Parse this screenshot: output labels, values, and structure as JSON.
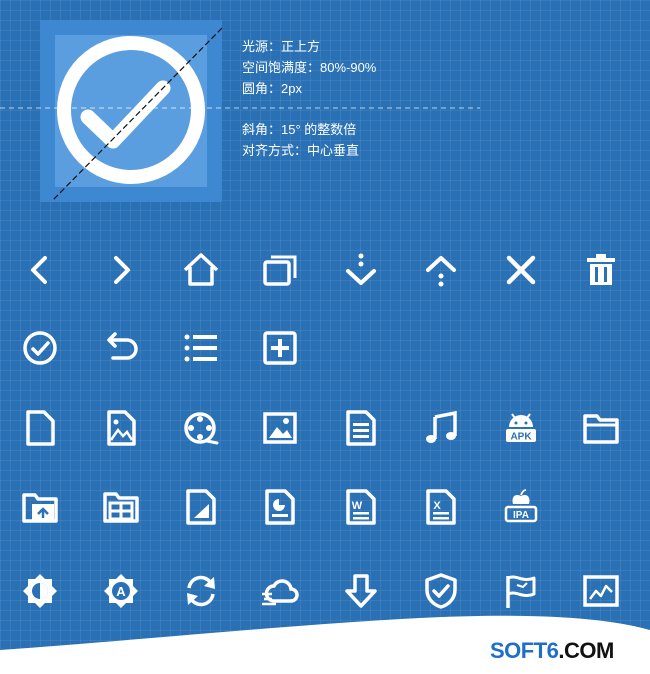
{
  "spec": {
    "lines_top": [
      "光源：正上方",
      "空间饱满度：80%-90%",
      "圆角：2px"
    ],
    "lines_bottom": [
      "斜角：15° 的整数倍",
      "对齐方式：中心垂直"
    ]
  },
  "icons": {
    "row1": [
      "chevron-left-icon",
      "chevron-right-icon",
      "home-icon",
      "windows-icon",
      "arrow-down-dots-icon",
      "arrow-up-dots-icon",
      "close-icon",
      "trash-icon"
    ],
    "row2": [
      "check-circle-icon",
      "undo-icon",
      "list-icon",
      "add-box-icon"
    ],
    "row3": [
      "file-icon",
      "image-file-icon",
      "film-reel-icon",
      "picture-icon",
      "document-icon",
      "music-note-icon",
      "android-apk-icon",
      "folder-icon"
    ],
    "row4": [
      "folder-upload-icon",
      "folder-grid-icon",
      "file-chart-icon",
      "file-pie-icon",
      "word-file-icon",
      "excel-file-icon",
      "ipa-package-icon"
    ],
    "row5": [
      "brightness-icon",
      "auto-brightness-icon",
      "sync-icon",
      "cloud-icon",
      "download-arrow-icon",
      "shield-check-icon",
      "flag-icon",
      "chart-window-icon"
    ]
  },
  "badges": {
    "apk": "APK",
    "ipa": "IPA",
    "auto": "A",
    "word": "W",
    "excel": "X"
  },
  "brand": {
    "part1": "SOFT6",
    "part2": ".COM"
  }
}
